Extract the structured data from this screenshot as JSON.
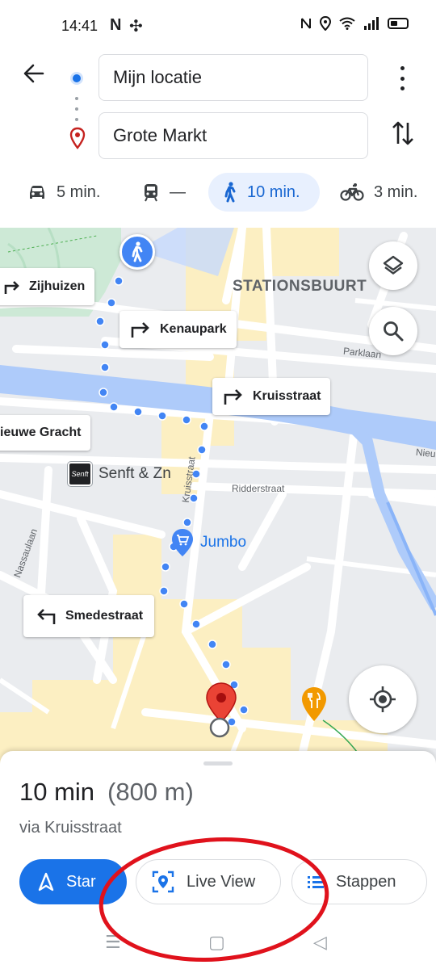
{
  "status_bar": {
    "time": "14:41",
    "left_icons": [
      "N",
      "fan-icon"
    ],
    "right_icons": [
      "nfc-icon",
      "location-icon",
      "wifi-icon",
      "signal-icon",
      "battery-icon"
    ]
  },
  "directions": {
    "origin": "Mijn locatie",
    "destination": "Grote Markt",
    "modes": [
      {
        "id": "drive",
        "icon": "car-icon",
        "label": "5 min."
      },
      {
        "id": "transit",
        "icon": "train-icon",
        "label": "—"
      },
      {
        "id": "walk",
        "icon": "walk-icon",
        "label": "10 min.",
        "selected": true
      },
      {
        "id": "bike",
        "icon": "bike-icon",
        "label": "3 min."
      }
    ]
  },
  "map": {
    "area_label": "STATIONSBUURT",
    "street_labels": {
      "parklaan": "Parklaan",
      "ridderstraat": "Ridderstraat",
      "kruisstraat_road": "Kruisstraat",
      "nassaulaan": "Nassaulaan",
      "nieu": "Nieu"
    },
    "turns": {
      "zijhuizen": "Zijhuizen",
      "kenaupark": "Kenaupark",
      "kruisstraat": "Kruisstraat",
      "nieuwe_gracht": "ieuwe Gracht",
      "smedestraat": "Smedestraat"
    },
    "pois": {
      "senft": "Senft & Zn",
      "senft_logo": "Senft",
      "jumbo": "Jumbo"
    },
    "colors": {
      "route": "#4285f4",
      "water": "#aecbfa",
      "park": "#cde9d6",
      "pedestrian": "#fcefc2",
      "destination_pin": "#ea4335"
    }
  },
  "sheet": {
    "duration": "10 min",
    "distance": "(800 m)",
    "via": "via Kruisstraat",
    "buttons": {
      "start": "Star",
      "live_view": "Live View",
      "steps": "Stappen"
    }
  },
  "nav": {
    "recents": "☰",
    "home": "▢",
    "back": "◁"
  }
}
